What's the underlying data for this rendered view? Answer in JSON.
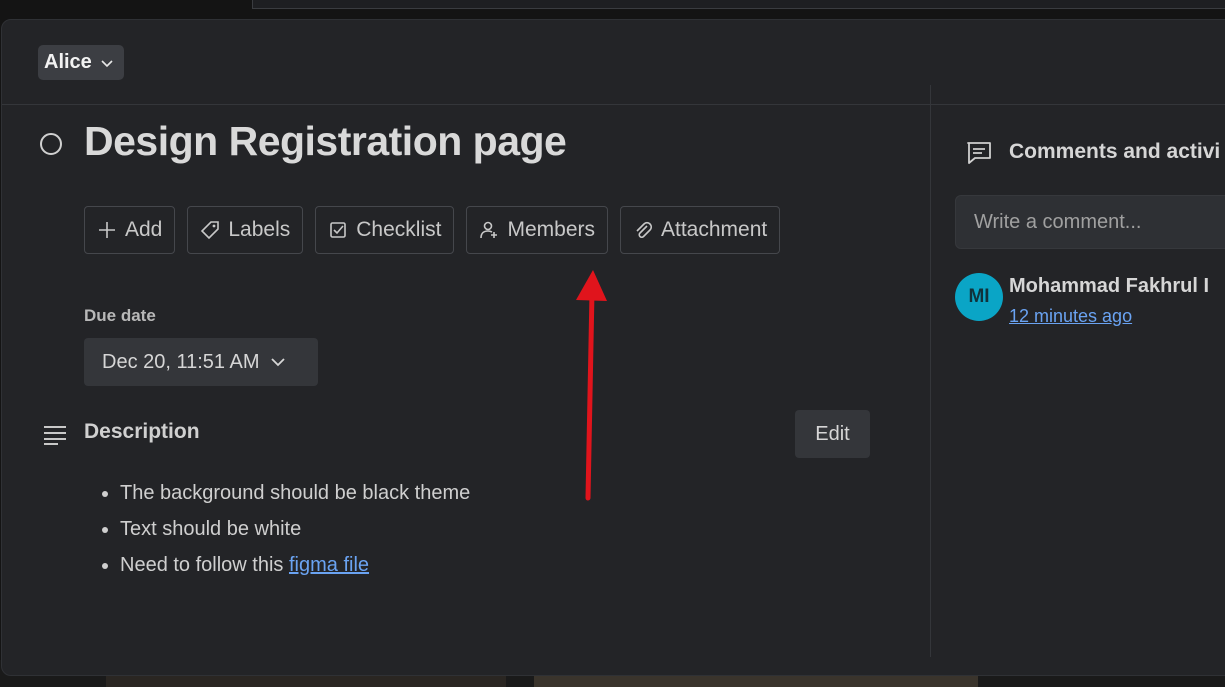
{
  "header": {
    "board_name": "Alice"
  },
  "card": {
    "title": "Design Registration page",
    "actions": [
      {
        "label": "Add"
      },
      {
        "label": "Labels"
      },
      {
        "label": "Checklist"
      },
      {
        "label": "Members"
      },
      {
        "label": "Attachment"
      }
    ],
    "due_date": {
      "label": "Due date",
      "value": "Dec 20, 11:51 AM"
    },
    "description": {
      "title": "Description",
      "edit_label": "Edit",
      "items": [
        "The background should be black theme",
        "Text should be white"
      ],
      "last_item_prefix": "Need to follow this ",
      "last_item_link": "figma file"
    }
  },
  "comments": {
    "title": "Comments and activi",
    "input_placeholder": "Write a comment...",
    "activity": [
      {
        "initials": "MI",
        "author": "Mohammad Fakhrul I",
        "time": "12 minutes ago"
      }
    ]
  },
  "colors": {
    "modal_bg": "#232427",
    "accent_link": "#6aa3f2",
    "avatar_bg": "#0aa5c6",
    "annotation_arrow": "#e0141c"
  }
}
